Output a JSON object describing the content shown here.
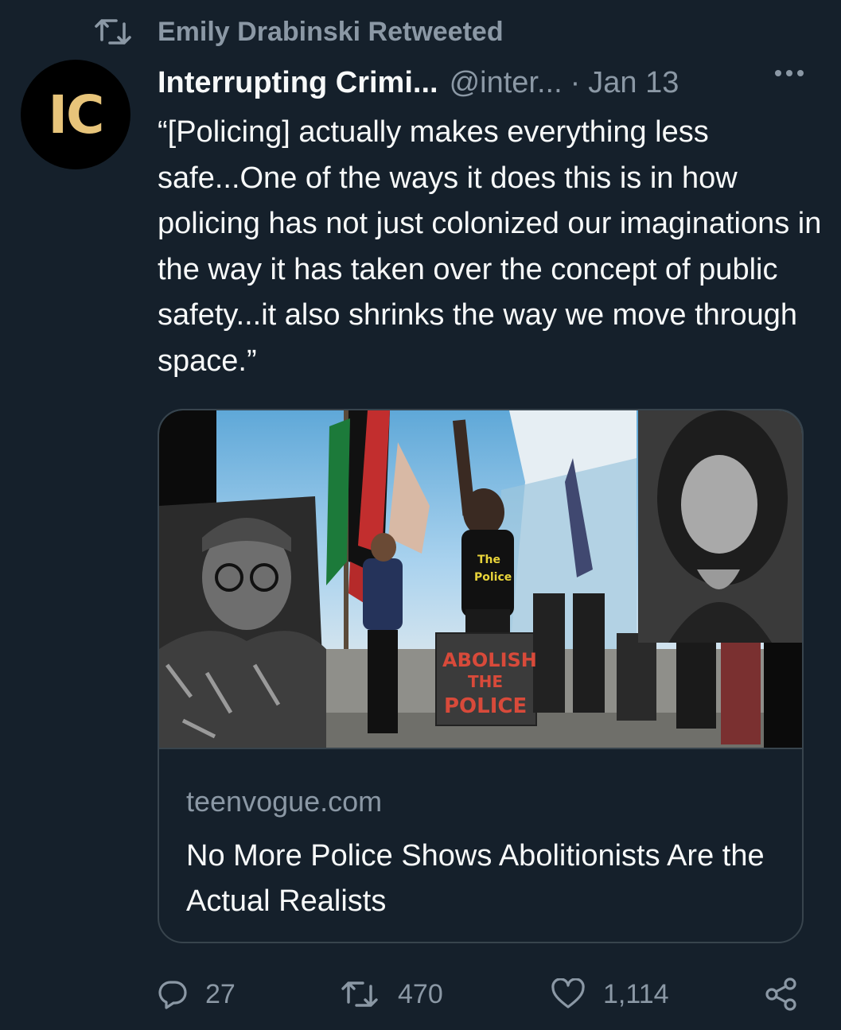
{
  "retweet": {
    "label": "Emily Drabinski Retweeted"
  },
  "author": {
    "avatar_text": "IC",
    "display_name": "Interrupting Crimi...",
    "handle": "@inter...",
    "separator": "·",
    "date": "Jan 13"
  },
  "tweet": {
    "text": "“[Policing] actually makes everything less safe...One of the ways it does this is in how policing has not just colonized our imaginations in the way it has taken over the concept of public safety...it also shrinks the way we move through space.”"
  },
  "card": {
    "image_sign_lines": [
      "ABOLISH",
      "THE",
      "POLICE"
    ],
    "shirt_lines": [
      "The",
      "Police"
    ],
    "domain": "teenvogue.com",
    "title": "No More Police Shows Abolitionists Are the Actual Realists"
  },
  "actions": {
    "reply_count": "27",
    "retweet_count": "470",
    "like_count": "1,114"
  },
  "icons": [
    "retweet-icon",
    "more-icon",
    "reply-icon",
    "retweet-icon",
    "like-icon",
    "share-icon"
  ],
  "colors": {
    "background": "#15202b",
    "secondary_text": "#8b98a5",
    "primary_text": "#f7f9f9",
    "border": "#38444d",
    "avatar_letters": "#e7c47a"
  }
}
